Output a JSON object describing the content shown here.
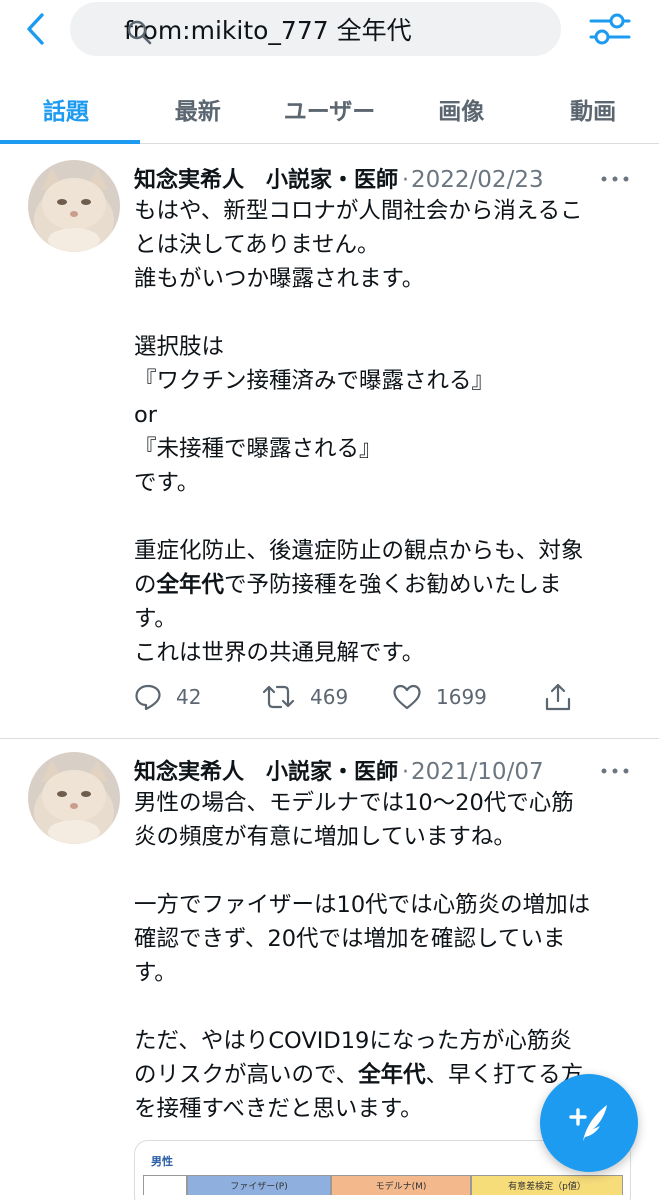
{
  "search": {
    "query": "from:mikito_777 全年代"
  },
  "tabs": [
    {
      "label": "話題",
      "active": true
    },
    {
      "label": "最新",
      "active": false
    },
    {
      "label": "ユーザー",
      "active": false
    },
    {
      "label": "画像",
      "active": false
    },
    {
      "label": "動画",
      "active": false
    }
  ],
  "tweets": [
    {
      "author": "知念実希人　小説家・医師",
      "separator": "·",
      "date": "2022/02/23",
      "lines": [
        "もはや、新型コロナが人間社会から消えるこ",
        "とは決してありません。",
        "誰もがいつか曝露されます。",
        "",
        "選択肢は",
        "『ワクチン接種済みで曝露される』",
        "or",
        "『未接種で曝露される』",
        "です。",
        "",
        "重症化防止、後遺症防止の観点からも、対象",
        "の全年代で予防接種を強くお勧めいたしま",
        "す。",
        "これは世界の共通見解です。"
      ],
      "bold_line_11_pre": "の",
      "bold_line_11_bold": "全年代",
      "bold_line_11_post": "で予防接種を強くお勧めいたしま",
      "replies": "42",
      "retweets": "469",
      "likes": "1699"
    },
    {
      "author": "知念実希人　小説家・医師",
      "separator": "·",
      "date": "2021/10/07",
      "lines": [
        "男性の場合、モデルナでは10〜20代で心筋",
        "炎の頻度が有意に増加していますね。",
        "",
        "一方でファイザーは10代では心筋炎の増加は",
        "確認できず、20代では増加を確認していま",
        "す。",
        "",
        "ただ、やはりCOVID19になった方が心筋炎",
        "のリスクが高いので、全年代、早く打てる方",
        "を接種すべきだと思います。"
      ],
      "bold_line_8_pre": "のリスクが高いので、",
      "bold_line_8_bold": "全年代",
      "bold_line_8_post": "、早く打てる方"
    }
  ],
  "embed": {
    "title": "男性",
    "cells": [
      "",
      "ファイザー(P)",
      "モデルナ(M)",
      "有意差検定（p値）"
    ]
  },
  "colors": {
    "accent": "#1d9bf0",
    "muted": "#5b6670",
    "cell_pfizer": "#8fb0de",
    "cell_moderna": "#f3b98d",
    "cell_test": "#f7dc7a"
  },
  "icons": {
    "back": "chevron-left-icon",
    "search": "search-icon",
    "filter": "sliders-icon",
    "more": "more-dots-icon",
    "reply": "reply-icon",
    "retweet": "retweet-icon",
    "like": "heart-icon",
    "share": "share-icon",
    "compose": "compose-icon"
  }
}
